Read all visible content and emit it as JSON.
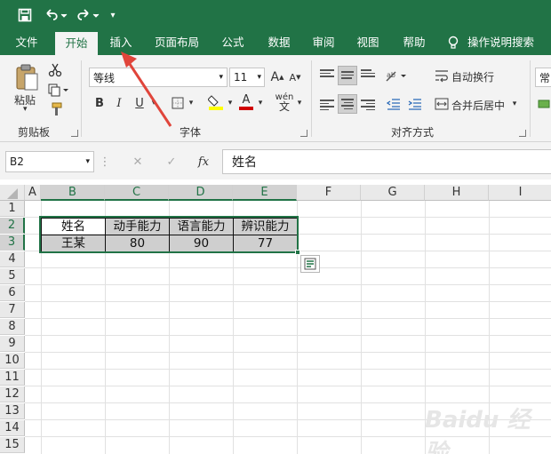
{
  "colors": {
    "accent": "#217346",
    "arrow": "#e0453b",
    "font_red": "#d00000",
    "highlight_yellow": "#ffff00"
  },
  "tabs": [
    "文件",
    "开始",
    "插入",
    "页面布局",
    "公式",
    "数据",
    "审阅",
    "视图",
    "帮助",
    "操作说明搜索"
  ],
  "active_tab": "开始",
  "ribbon": {
    "paste_label": "粘贴",
    "clipboard_label": "剪贴板",
    "font_name": "等线",
    "font_size": "11",
    "font_group_label": "字体",
    "wrap_label": "自动换行",
    "merge_label": "合并后居中",
    "align_group_label": "对齐方式",
    "number_format_partial": "常"
  },
  "formula_bar": {
    "name_box": "B2",
    "fx": "fx",
    "content": "姓名"
  },
  "grid": {
    "columns": [
      "A",
      "B",
      "C",
      "D",
      "E",
      "F",
      "G",
      "H",
      "I"
    ],
    "rows": [
      "1",
      "2",
      "3",
      "4",
      "5",
      "6",
      "7",
      "8",
      "9",
      "10",
      "11",
      "12",
      "13",
      "14",
      "15"
    ],
    "table": {
      "header": [
        "姓名",
        "动手能力",
        "语言能力",
        "辨识能力"
      ],
      "row": [
        "王某",
        "80",
        "90",
        "77"
      ]
    }
  },
  "watermark": "Baidu 经验"
}
